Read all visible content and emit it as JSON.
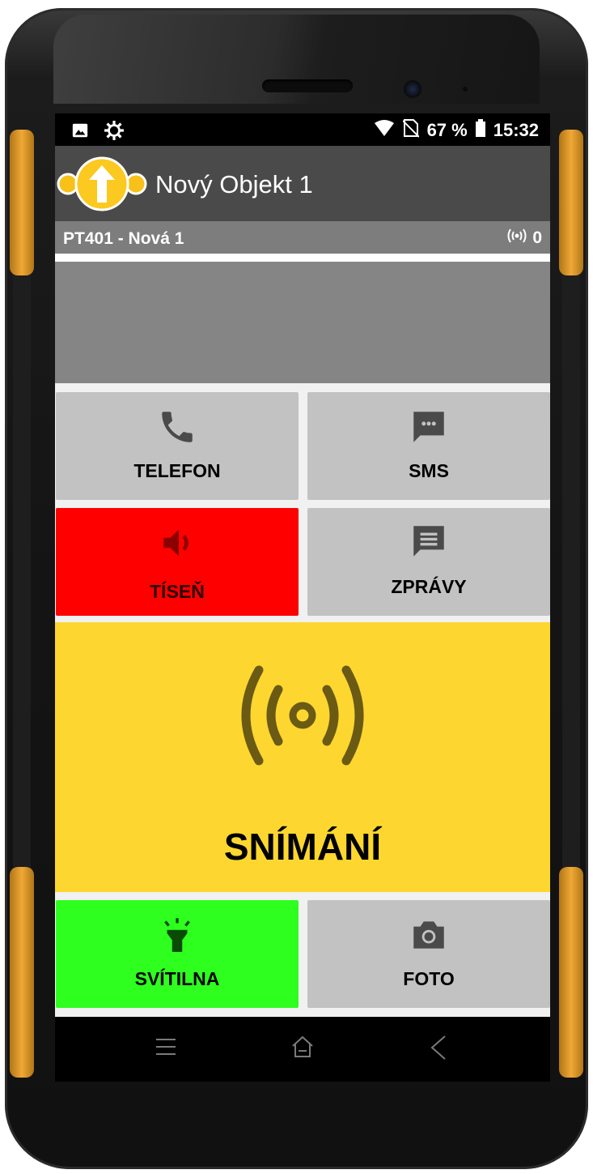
{
  "status_bar": {
    "battery": "67 %",
    "time": "15:32"
  },
  "app_bar": {
    "title": "Nový Objekt 1"
  },
  "sub_bar": {
    "title": "PT401 - Nová 1",
    "count": "0"
  },
  "tiles": {
    "telefon": "TELEFON",
    "sms": "SMS",
    "tisen": "TÍSEŇ",
    "zpravy": "ZPRÁVY",
    "snimani": "SNÍMÁNÍ",
    "svitilna": "SVÍTILNA",
    "foto": "FOTO"
  },
  "colors": {
    "tisen_bg": "#ff0000",
    "snimani_bg": "#fdd72f",
    "svitilna_bg": "#2eff1f",
    "tile_bg": "#c2c2c2"
  }
}
